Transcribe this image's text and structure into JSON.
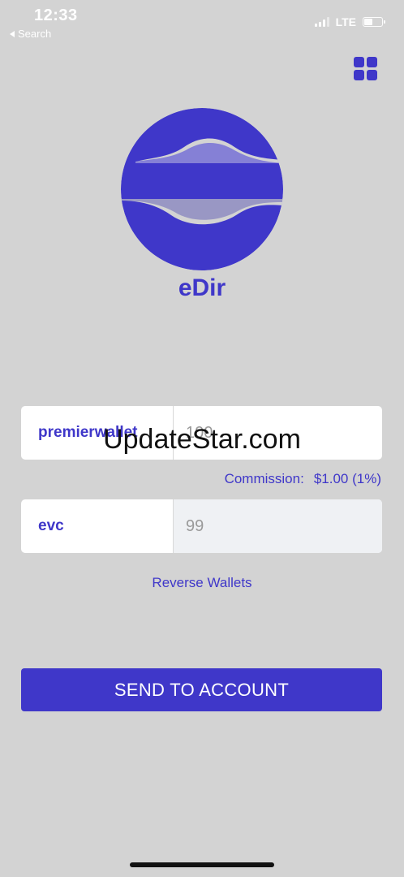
{
  "status_bar": {
    "time": "12:33",
    "back_app": "Search",
    "network": "LTE",
    "battery_level": 0.45
  },
  "header": {
    "menu_icon": "grid-icon"
  },
  "app": {
    "name": "eDir",
    "accent_color": "#3f37c9"
  },
  "from_wallet": {
    "label": "premierwallet",
    "amount": "100"
  },
  "commission": {
    "label": "Commission:",
    "value": "$1.00 (1%)"
  },
  "to_wallet": {
    "label": "evc",
    "amount": "99"
  },
  "reverse_label": "Reverse Wallets",
  "send_label": "SEND TO ACCOUNT",
  "watermark": "UpdateStar.com"
}
